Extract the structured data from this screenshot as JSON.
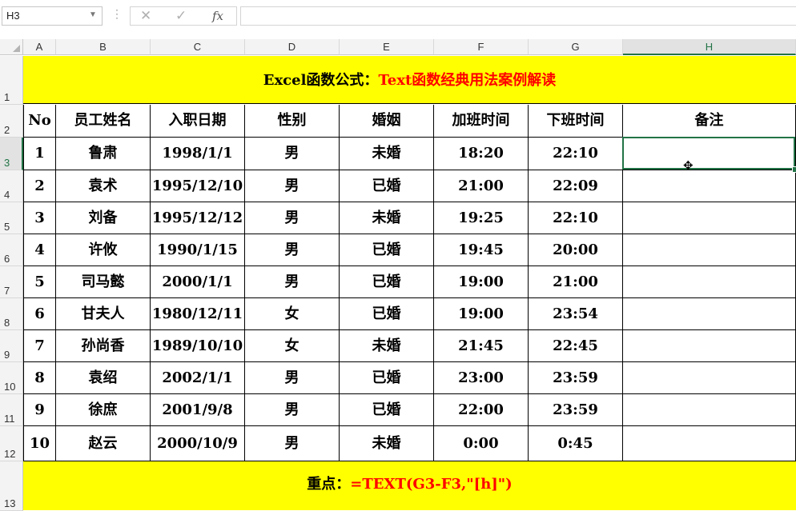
{
  "formula_bar": {
    "name_box": "H3",
    "cancel_icon": "✕",
    "enter_icon": "✓",
    "fx_label": "fx",
    "formula": ""
  },
  "columns": [
    "A",
    "B",
    "C",
    "D",
    "E",
    "F",
    "G",
    "H"
  ],
  "active_column": "H",
  "rows": [
    "1",
    "2",
    "3",
    "4",
    "5",
    "6",
    "7",
    "8",
    "9",
    "10",
    "11",
    "12",
    "13"
  ],
  "active_row": "3",
  "title": {
    "part1": "Excel函数公式：",
    "part2": "Text函数经典用法案例解读"
  },
  "table": {
    "headers": [
      "No",
      "员工姓名",
      "入职日期",
      "性别",
      "婚姻",
      "加班时间",
      "下班时间",
      "备注"
    ],
    "records": [
      [
        "1",
        "鲁肃",
        "1998/1/1",
        "男",
        "未婚",
        "18:20",
        "22:10",
        ""
      ],
      [
        "2",
        "袁术",
        "1995/12/10",
        "男",
        "已婚",
        "21:00",
        "22:09",
        ""
      ],
      [
        "3",
        "刘备",
        "1995/12/12",
        "男",
        "未婚",
        "19:25",
        "22:10",
        ""
      ],
      [
        "4",
        "许攸",
        "1990/1/15",
        "男",
        "已婚",
        "19:45",
        "20:00",
        ""
      ],
      [
        "5",
        "司马懿",
        "2000/1/1",
        "男",
        "已婚",
        "19:00",
        "21:00",
        ""
      ],
      [
        "6",
        "甘夫人",
        "1980/12/11",
        "女",
        "已婚",
        "19:00",
        "23:54",
        ""
      ],
      [
        "7",
        "孙尚香",
        "1989/10/10",
        "女",
        "未婚",
        "21:45",
        "22:45",
        ""
      ],
      [
        "8",
        "袁绍",
        "2002/1/1",
        "男",
        "已婚",
        "23:00",
        "23:59",
        ""
      ],
      [
        "9",
        "徐庶",
        "2001/9/8",
        "男",
        "已婚",
        "22:00",
        "23:59",
        ""
      ],
      [
        "10",
        "赵云",
        "2000/10/9",
        "男",
        "未婚",
        "0:00",
        "0:45",
        ""
      ]
    ]
  },
  "footer": {
    "label": "重点：",
    "formula": "=TEXT(G3-F3,\"[h]\")"
  },
  "colors": {
    "banner": "#ffff00",
    "accent_red": "#ff0000",
    "selection": "#217346"
  }
}
